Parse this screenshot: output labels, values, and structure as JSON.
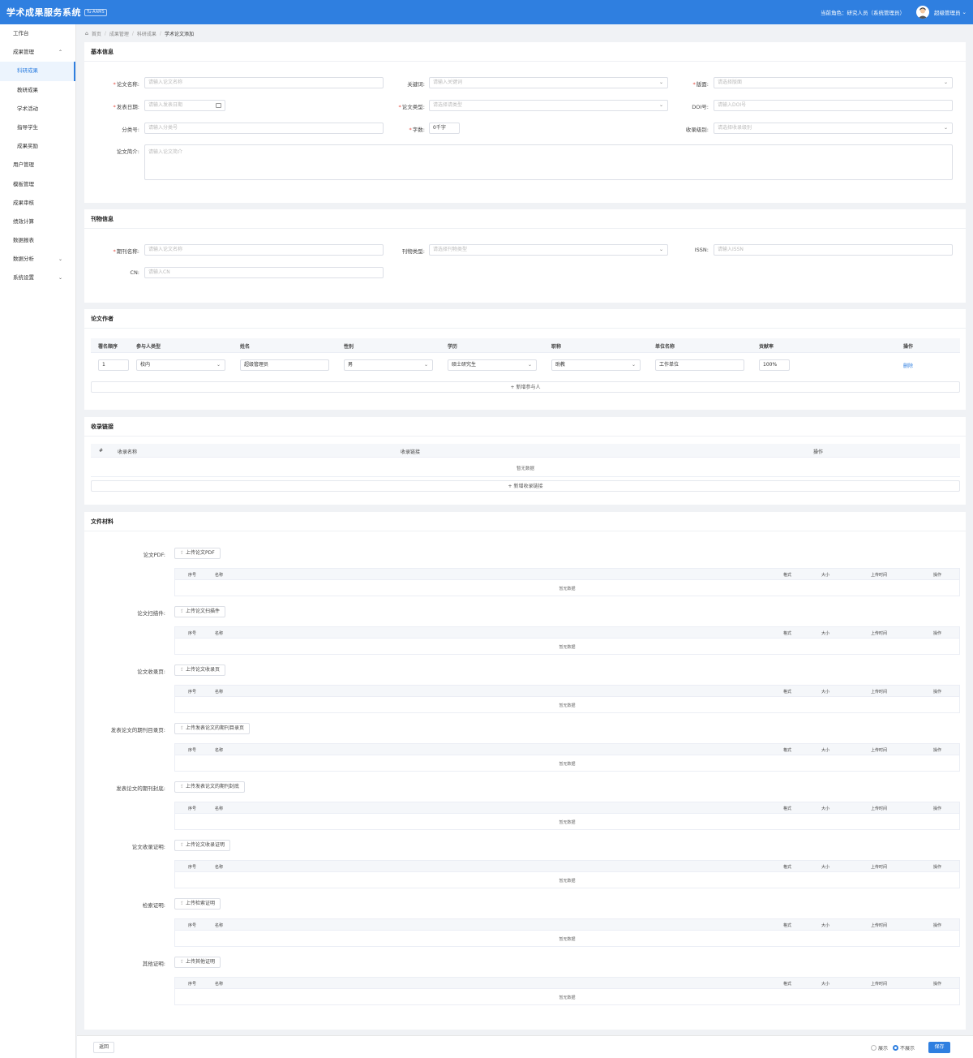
{
  "header": {
    "title": "学术成果服务系统",
    "badge": "Tu-AAMS",
    "role": "当前角色：研究人员（系统管理员）",
    "user": "超级管理员"
  },
  "sidebar": {
    "items": [
      {
        "label": "工作台"
      },
      {
        "label": "成果管理",
        "chev": "⌃"
      },
      {
        "label": "科研成果",
        "sub": true,
        "active": true
      },
      {
        "label": "教研成果",
        "sub": true
      },
      {
        "label": "学术活动",
        "sub": true
      },
      {
        "label": "指导学生",
        "sub": true
      },
      {
        "label": "成果奖励",
        "sub": true
      },
      {
        "label": "用户管理"
      },
      {
        "label": "模板管理"
      },
      {
        "label": "成果审核"
      },
      {
        "label": "绩效计算"
      },
      {
        "label": "数据报表"
      },
      {
        "label": "数据分析",
        "chev": "⌄"
      },
      {
        "label": "系统设置",
        "chev": "⌄"
      }
    ]
  },
  "breadcrumb": {
    "home": "首页",
    "l2": "成果管理",
    "l3": "科研成果",
    "cur": "学术论文添加",
    "sep": "/"
  },
  "basic": {
    "title": "基本信息",
    "name_l": "论文名称:",
    "name_p": "请输入论文名称",
    "kw_l": "关键词:",
    "kw_p": "请输入关键词",
    "ver_l": "版面:",
    "ver_p": "请选择版面",
    "date_l": "发表日期:",
    "date_p": "请输入发表日期",
    "type_l": "论文类型:",
    "type_p": "请选择请类型",
    "doi_l": "DOI号:",
    "doi_p": "请输入DOI号",
    "cls_l": "分类号:",
    "cls_p": "请输入分类号",
    "wc_l": "字数:",
    "wc_v": "0千字",
    "lvl_l": "收录级别:",
    "lvl_p": "请选择收录级别",
    "abs_l": "论文简介:",
    "abs_p": "请输入论文简介"
  },
  "journal": {
    "title": "刊物信息",
    "jn_l": "期刊名称:",
    "jn_p": "请输入论文名称",
    "jt_l": "刊物类型:",
    "jt_p": "请选择刊物类型",
    "issn_l": "ISSN:",
    "issn_p": "请输入ISSN",
    "cn_l": "CN:",
    "cn_p": "请输入CN"
  },
  "authors": {
    "title": "论文作者",
    "cols": [
      "署名顺序",
      "参与人类型",
      "姓名",
      "性别",
      "学历",
      "职称",
      "单位名称",
      "贡献率",
      "操作"
    ],
    "row": {
      "order": "1",
      "ptype": "校内",
      "name": "超级管理员",
      "gender": "男",
      "edu": "硕士研究生",
      "rank": "助教",
      "unit": "工作单位",
      "rate": "100%",
      "op": "删除"
    },
    "add": "+ 新增参与人"
  },
  "links": {
    "title": "收录链接",
    "cols": [
      "#",
      "收录名称",
      "收录链接",
      "操作"
    ],
    "empty": "暂无数据",
    "add": "+ 新增收录链接"
  },
  "files": {
    "title": "文件材料",
    "cols": [
      "序号",
      "名称",
      "格式",
      "大小",
      "上传时间",
      "操作"
    ],
    "empty": "暂无数据",
    "items": [
      {
        "label": "论文PDF:",
        "btn": "上传论文PDF"
      },
      {
        "label": "论文扫描件:",
        "btn": "上传论文扫描件"
      },
      {
        "label": "论文收录页:",
        "btn": "上传论文收录页"
      },
      {
        "label": "发表论文的期刊目录页:",
        "btn": "上传发表论文的期刊目录页"
      },
      {
        "label": "发表论文的期刊封底:",
        "btn": "上传发表论文的期刊封底"
      },
      {
        "label": "论文收录证明:",
        "btn": "上传论文收录证明"
      },
      {
        "label": "检索证明:",
        "btn": "上传检索证明"
      },
      {
        "label": "其他证明:",
        "btn": "上传其他证明"
      }
    ]
  },
  "footer": {
    "back": "返回",
    "show": "展示",
    "hide": "不展示",
    "save": "保存"
  },
  "icons": {
    "dropdown": "⌄",
    "upload": "⇪",
    "home": "⌂"
  },
  "colors": {
    "primary": "#2f7fe0",
    "required": "#e5483c"
  }
}
